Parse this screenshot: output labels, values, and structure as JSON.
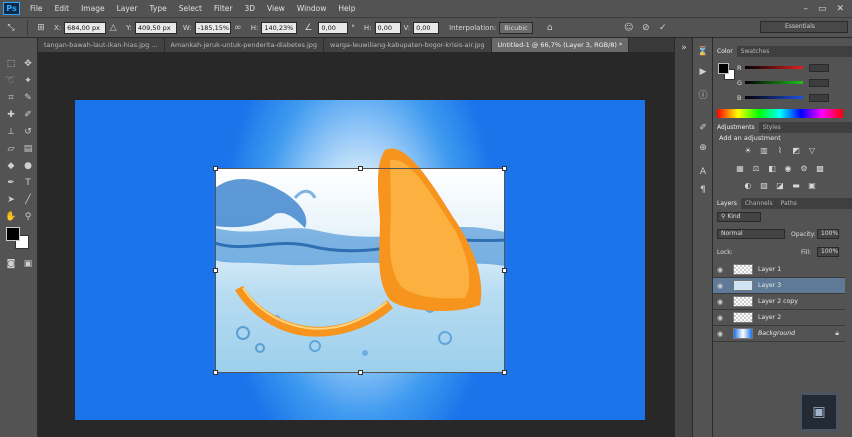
{
  "app": {
    "logo": "Ps"
  },
  "menubar": {
    "items": [
      "File",
      "Edit",
      "Image",
      "Layer",
      "Type",
      "Select",
      "Filter",
      "3D",
      "View",
      "Window",
      "Help"
    ],
    "minimize": "–",
    "restore": "▭",
    "close": "✕"
  },
  "options": {
    "x_label": "X:",
    "x_value": "684,00 px",
    "y_label": "Y:",
    "y_value": "409,50 px",
    "w_label": "W:",
    "w_value": "-185,15%",
    "h_label": "H:",
    "h_value": "140,23%",
    "angle_value": "0,00",
    "angle_unit": "°",
    "h_skew_label": "H:",
    "h_skew_value": "0,00",
    "v_skew_label": "V:",
    "v_skew_value": "0,00",
    "interpolation_label": "Interpolation:",
    "interpolation_value": "Bicubic",
    "workspace": "Essentials"
  },
  "tabs": [
    {
      "label": "tangan-bawah-laut-ikan-hias.jpg ..."
    },
    {
      "label": "Amankah-jeruk-untuk-penderita-diabetes.jpg"
    },
    {
      "label": "warga-leuwiliang-kabupaten-bogor-krisis-air.jpg"
    },
    {
      "label": "Untitled-1 @ 66,7% (Layer 3, RGB/8) *"
    }
  ],
  "color_panel": {
    "tabs": [
      "Color",
      "Swatches"
    ],
    "channels": [
      "R",
      "G",
      "B"
    ],
    "channel_colors": [
      "#e02020",
      "#20c020",
      "#2050e0"
    ]
  },
  "adjustments_panel": {
    "tabs": [
      "Adjustments",
      "Styles"
    ],
    "title": "Add an adjustment"
  },
  "layers_panel": {
    "tabs": [
      "Layers",
      "Channels",
      "Paths"
    ],
    "kind": "Kind",
    "blend_mode": "Normal",
    "opacity_label": "Opacity:",
    "opacity_value": "100%",
    "lock_label": "Lock:",
    "fill_label": "Fill:",
    "fill_value": "100%",
    "layers": [
      {
        "name": "Layer 1",
        "selected": false
      },
      {
        "name": "Layer 3",
        "selected": true
      },
      {
        "name": "Layer 2 copy",
        "selected": false
      },
      {
        "name": "Layer 2",
        "selected": false
      },
      {
        "name": "Background",
        "selected": false,
        "locked": true
      }
    ]
  },
  "colors": {
    "foreground": "#000000",
    "background": "#ffffff",
    "selection": "#5e7a96"
  }
}
